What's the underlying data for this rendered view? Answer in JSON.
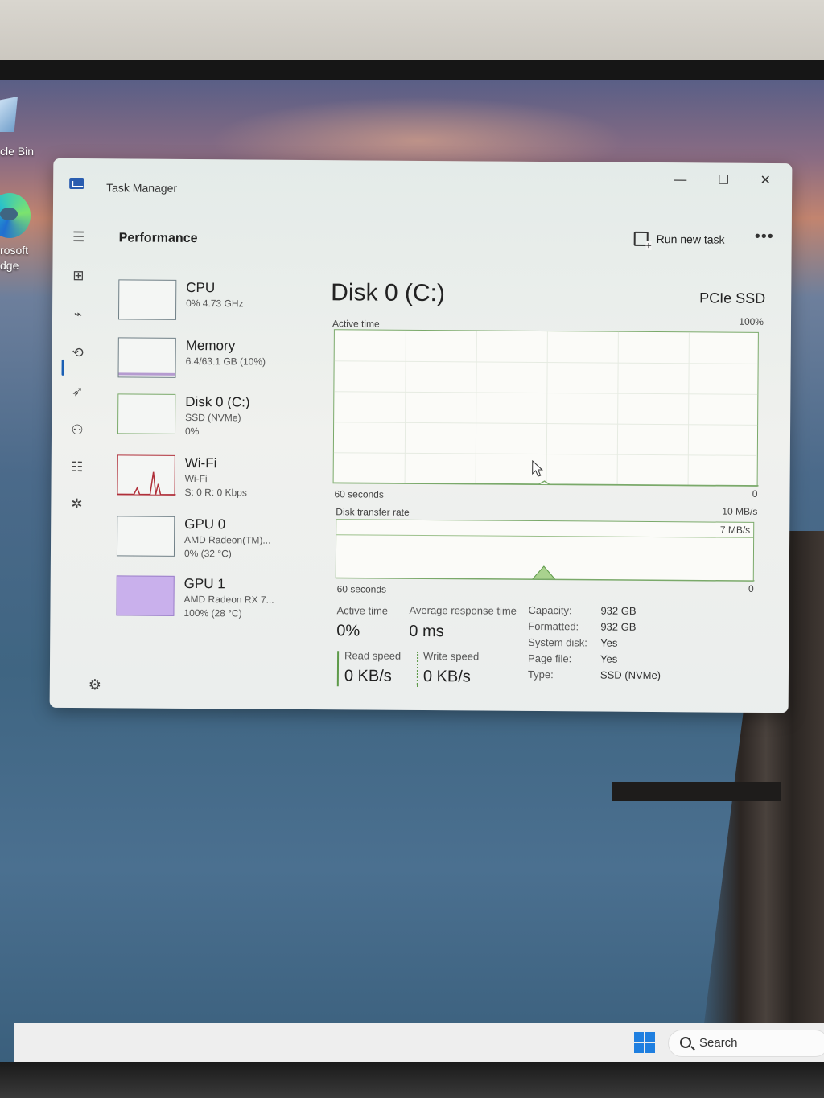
{
  "desktop": {
    "recycle_label": "cle Bin",
    "edge_label_line1": "rosoft",
    "edge_label_line2": "dge"
  },
  "window": {
    "title": "Task Manager",
    "minimize_glyph": "—",
    "maximize_glyph": "☐",
    "close_glyph": "✕"
  },
  "header": {
    "page_title": "Performance",
    "run_task_label": "Run new task",
    "more_glyph": "•••"
  },
  "nav": {
    "icons": [
      "hamburger-icon",
      "processes-icon",
      "performance-icon",
      "app-history-icon",
      "startup-apps-icon",
      "users-icon",
      "details-icon",
      "services-icon",
      "settings-icon"
    ],
    "glyphs": [
      "☰",
      "⊞",
      "⌁",
      "⟲",
      "➶",
      "⚇",
      "☷",
      "✲",
      "⚙"
    ],
    "active_index": 2
  },
  "devices": [
    {
      "name": "CPU",
      "line1": "0% 4.73 GHz",
      "line2": ""
    },
    {
      "name": "Memory",
      "line1": "6.4/63.1 GB (10%)",
      "line2": ""
    },
    {
      "name": "Disk 0 (C:)",
      "line1": "SSD (NVMe)",
      "line2": "0%"
    },
    {
      "name": "Wi-Fi",
      "line1": "Wi-Fi",
      "line2": "S: 0 R: 0 Kbps"
    },
    {
      "name": "GPU 0",
      "line1": "AMD Radeon(TM)...",
      "line2": "0% (32 °C)"
    },
    {
      "name": "GPU 1",
      "line1": "AMD Radeon RX 7...",
      "line2": "100% (28 °C)"
    }
  ],
  "main": {
    "disk_title": "Disk 0 (C:)",
    "disk_type": "PCIe SSD",
    "active_time_label": "Active time",
    "active_time_max": "100%",
    "active_time_seconds": "60 seconds",
    "active_time_min": "0",
    "transfer_label": "Disk transfer rate",
    "transfer_max": "10 MB/s",
    "transfer_mid": "7 MB/s",
    "transfer_seconds": "60 seconds",
    "transfer_min": "0"
  },
  "stats": {
    "active_time_label": "Active time",
    "active_time_value": "0%",
    "avg_response_label": "Average response time",
    "avg_response_value": "0 ms",
    "read_speed_label": "Read speed",
    "read_speed_value": "0 KB/s",
    "write_speed_label": "Write speed",
    "write_speed_value": "0 KB/s"
  },
  "properties": [
    {
      "key": "Capacity:",
      "value": "932 GB"
    },
    {
      "key": "Formatted:",
      "value": "932 GB"
    },
    {
      "key": "System disk:",
      "value": "Yes"
    },
    {
      "key": "Page file:",
      "value": "Yes"
    },
    {
      "key": "Type:",
      "value": "SSD (NVMe)"
    }
  ],
  "taskbar": {
    "search_label": "Search"
  },
  "colors": {
    "disk_accent": "#7aa96a",
    "wifi_accent": "#b0303a",
    "gpu1_accent": "#c9b0ec"
  }
}
